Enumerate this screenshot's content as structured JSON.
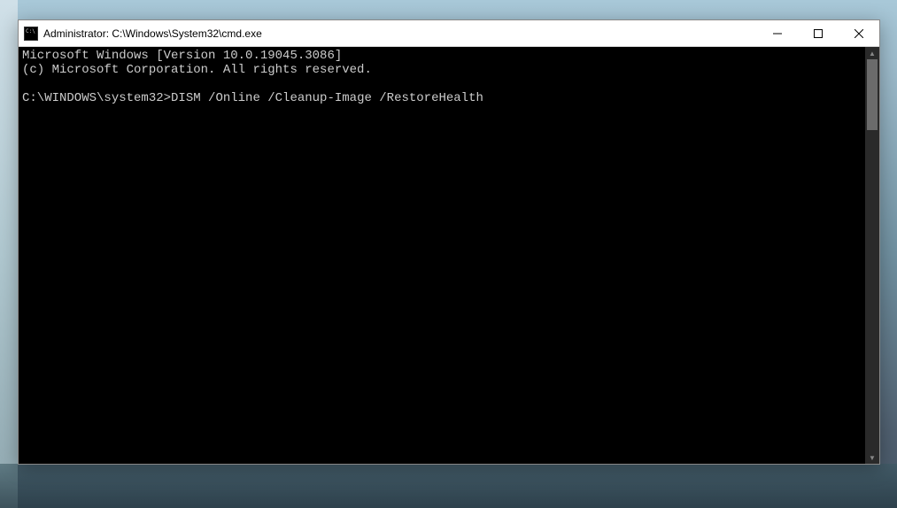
{
  "window": {
    "title": "Administrator: C:\\Windows\\System32\\cmd.exe"
  },
  "console": {
    "line1": "Microsoft Windows [Version 10.0.19045.3086]",
    "line2": "(c) Microsoft Corporation. All rights reserved.",
    "blank": "",
    "prompt": "C:\\WINDOWS\\system32>",
    "command": "DISM /Online /Cleanup-Image /RestoreHealth"
  }
}
